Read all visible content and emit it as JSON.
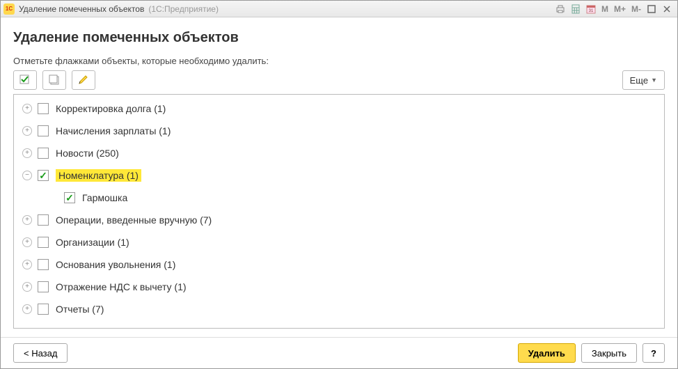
{
  "titlebar": {
    "logo_text": "1C",
    "title": "Удаление помеченных объектов",
    "subtitle": "(1С:Предприятие)",
    "m_buttons": [
      "M",
      "M+",
      "M-"
    ]
  },
  "page": {
    "heading": "Удаление помеченных объектов",
    "instruction": "Отметьте флажками объекты, которые необходимо удалить:"
  },
  "toolbar": {
    "more_label": "Еще"
  },
  "tree": [
    {
      "label": "Корректировка долга (1)",
      "expanded": false,
      "checked": false,
      "level": 0
    },
    {
      "label": "Начисления зарплаты (1)",
      "expanded": false,
      "checked": false,
      "level": 0
    },
    {
      "label": "Новости (250)",
      "expanded": false,
      "checked": false,
      "level": 0
    },
    {
      "label": "Номенклатура (1)",
      "expanded": true,
      "checked": true,
      "level": 0,
      "highlight": true
    },
    {
      "label": "Гармошка",
      "expanded": null,
      "checked": true,
      "level": 1
    },
    {
      "label": "Операции, введенные вручную (7)",
      "expanded": false,
      "checked": false,
      "level": 0
    },
    {
      "label": "Организации (1)",
      "expanded": false,
      "checked": false,
      "level": 0
    },
    {
      "label": "Основания увольнения (1)",
      "expanded": false,
      "checked": false,
      "level": 0
    },
    {
      "label": "Отражение НДС к вычету (1)",
      "expanded": false,
      "checked": false,
      "level": 0
    },
    {
      "label": "Отчеты (7)",
      "expanded": false,
      "checked": false,
      "level": 0
    }
  ],
  "footer": {
    "back": "< Назад",
    "delete": "Удалить",
    "close": "Закрыть",
    "help": "?"
  }
}
